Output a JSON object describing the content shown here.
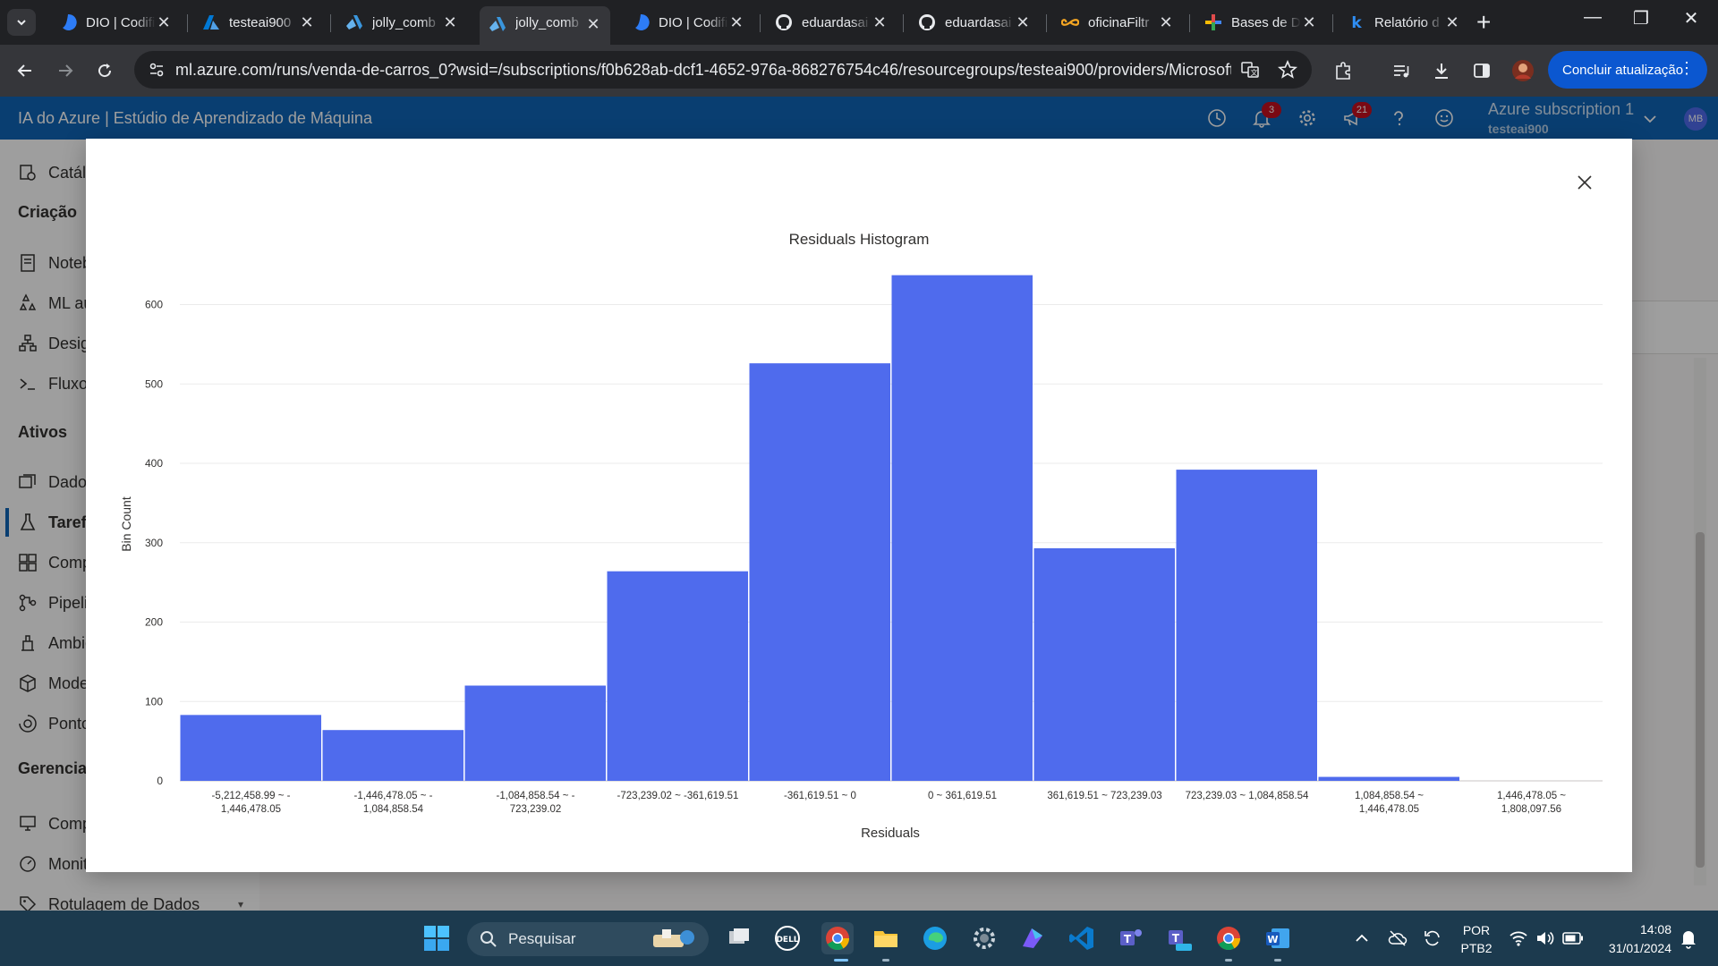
{
  "browser": {
    "tabs": [
      {
        "title": "DIO | Codifi",
        "icon": "dio-icon"
      },
      {
        "title": "testeai900",
        "icon": "azure-icon"
      },
      {
        "title": "jolly_comb",
        "icon": "azureml-icon"
      },
      {
        "title": "jolly_comb",
        "icon": "azureml-icon",
        "active": true
      },
      {
        "title": "DIO | Codifi",
        "icon": "dio-icon"
      },
      {
        "title": "eduardasai",
        "icon": "github-icon"
      },
      {
        "title": "eduardasai",
        "icon": "github-icon"
      },
      {
        "title": "oficinaFiltr",
        "icon": "infinity-icon"
      },
      {
        "title": "Bases de D",
        "icon": "plus-color-icon"
      },
      {
        "title": "Relatório d",
        "icon": "k-icon"
      }
    ],
    "url": "ml.azure.com/runs/venda-de-carros_0?wsid=/subscriptions/f0b628ab-dcf1-4652-976a-868276754c46/resourcegroups/testeai900/providers/Microsoft....",
    "update_button": "Concluir atualização"
  },
  "azure": {
    "title": "IA do Azure | Estúdio de Aprendizado de Máquina",
    "notifications_count": "3",
    "feedback_count": "21",
    "subscription_name": "Azure subscription 1",
    "subscription_id": "testeai900",
    "avatar_initials": "MB"
  },
  "sidenav": {
    "items": [
      {
        "label": "Catálogo",
        "icon": "catalog-icon"
      },
      {
        "label": "Criação",
        "heading": true
      },
      {
        "label": "Notebooks",
        "icon": "notebook-icon"
      },
      {
        "label": "ML automatizado",
        "icon": "automl-icon"
      },
      {
        "label": "Designer",
        "icon": "designer-icon"
      },
      {
        "label": "Fluxo de prompt",
        "icon": "prompt-flow-icon"
      },
      {
        "label": "Ativos",
        "heading": true
      },
      {
        "label": "Dados",
        "icon": "data-icon"
      },
      {
        "label": "Tarefas",
        "icon": "jobs-icon",
        "selected": true
      },
      {
        "label": "Componentes",
        "icon": "components-icon"
      },
      {
        "label": "Pipelines",
        "icon": "pipelines-icon"
      },
      {
        "label": "Ambientes",
        "icon": "environments-icon"
      },
      {
        "label": "Modelos",
        "icon": "models-icon"
      },
      {
        "label": "Pontos de extremidade",
        "icon": "endpoints-icon"
      },
      {
        "label": "Gerenciar",
        "heading": true
      },
      {
        "label": "Computação",
        "icon": "compute-icon"
      },
      {
        "label": "Monitoramento",
        "icon": "monitoring-icon"
      },
      {
        "label": "Rotulagem de Dados",
        "icon": "labeling-icon"
      }
    ]
  },
  "chart_data": {
    "type": "bar",
    "title": "Residuals Histogram",
    "xlabel": "Residuals",
    "ylabel": "Bin Count",
    "ylim": [
      0,
      640
    ],
    "yticks": [
      0,
      100,
      200,
      300,
      400,
      500,
      600
    ],
    "grid": true,
    "legend": "none",
    "bar_color": "#4f6bed",
    "categories": [
      "-5,212,458.99 ~ -1,446,478.05",
      "-1,446,478.05 ~ -1,084,858.54",
      "-1,084,858.54 ~ -723,239.02",
      "-723,239.02 ~ -361,619.51",
      "-361,619.51 ~ 0",
      "0 ~ 361,619.51",
      "361,619.51 ~ 723,239.03",
      "723,239.03 ~ 1,084,858.54",
      "1,084,858.54 ~ 1,446,478.05",
      "1,446,478.05 ~ 1,808,097.56"
    ],
    "values": [
      83,
      64,
      120,
      264,
      526,
      637,
      293,
      392,
      5,
      0
    ]
  },
  "taskbar": {
    "search_placeholder": "Pesquisar",
    "language": "POR",
    "keyboard": "PTB2",
    "time": "14:08",
    "date": "31/01/2024"
  }
}
